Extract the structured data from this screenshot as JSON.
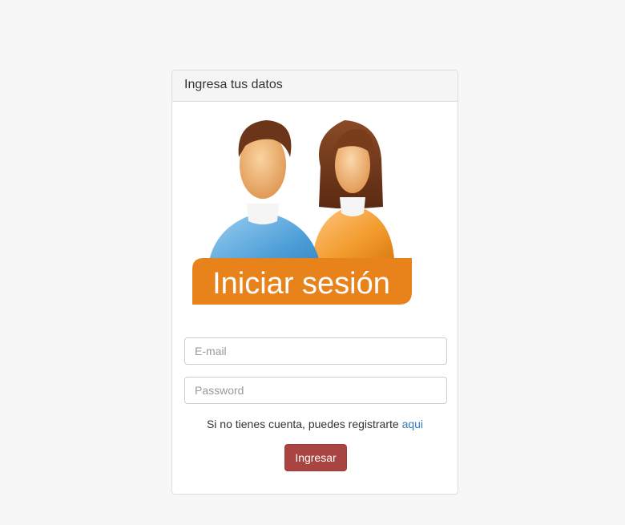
{
  "panel": {
    "heading": "Ingresa tus datos"
  },
  "hero": {
    "banner_text": "Iniciar sesión",
    "icon": "users-login-icon",
    "banner_color": "#e8821a"
  },
  "form": {
    "email_placeholder": "E-mail",
    "password_placeholder": "Password",
    "register_text": "Si no tienes cuenta, puedes registrarte",
    "register_link": "aqui",
    "submit_label": "Ingresar"
  },
  "colors": {
    "submit_bg": "#a94442",
    "link": "#337ab7"
  }
}
